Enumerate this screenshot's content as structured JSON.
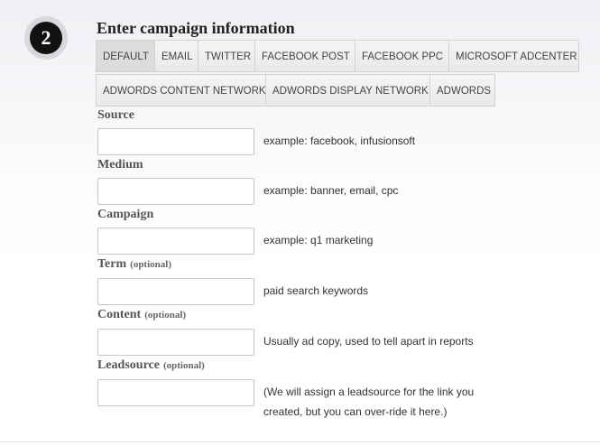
{
  "step": {
    "number": "2"
  },
  "heading": "Enter campaign information",
  "tabs": {
    "row1": [
      "DEFAULT",
      "EMAIL",
      "TWITTER",
      "FACEBOOK POST",
      "FACEBOOK PPC",
      "MICROSOFT ADCENTER"
    ],
    "row2": [
      "ADWORDS CONTENT NETWORK",
      "ADWORDS DISPLAY NETWORK",
      "ADWORDS"
    ],
    "active": "DEFAULT"
  },
  "fields": {
    "source": {
      "label": "Source",
      "optional": "",
      "value": "",
      "hint": "example: facebook, infusionsoft"
    },
    "medium": {
      "label": "Medium",
      "optional": "",
      "value": "",
      "hint": "example: banner, email, cpc"
    },
    "campaign": {
      "label": "Campaign",
      "optional": "",
      "value": "",
      "hint": "example: q1 marketing"
    },
    "term": {
      "label": "Term",
      "optional": "(optional)",
      "value": "",
      "hint": "paid search keywords"
    },
    "content": {
      "label": "Content",
      "optional": "(optional)",
      "value": "",
      "hint": "Usually ad copy, used to tell apart in reports"
    },
    "leadsource": {
      "label": "Leadsource",
      "optional": "(optional)",
      "value": "",
      "hint": "(We will assign a leadsource for the link you created, but you can over-ride it here.)"
    }
  }
}
